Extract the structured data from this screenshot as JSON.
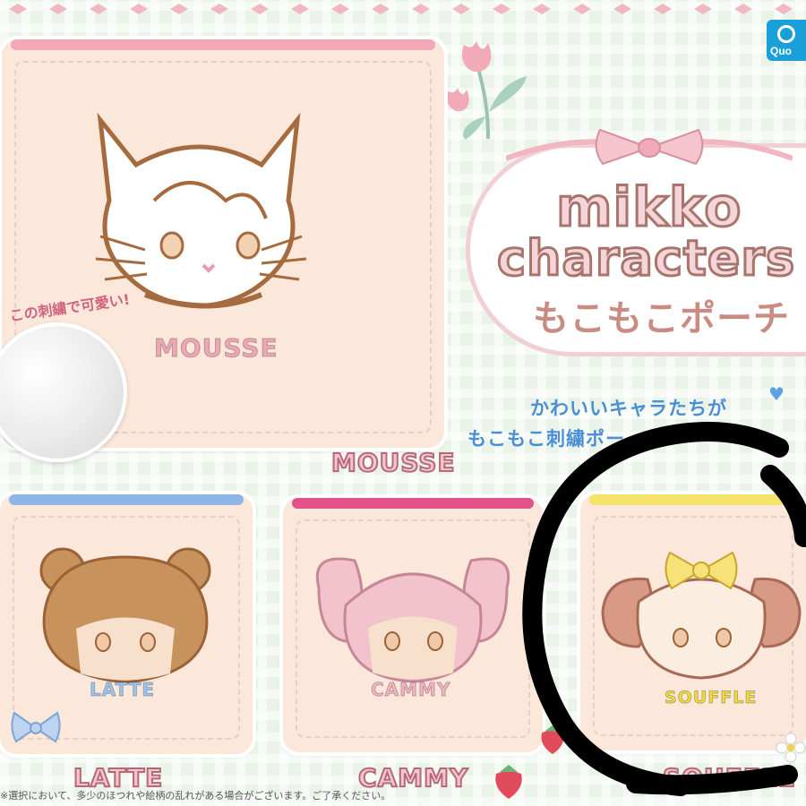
{
  "brand": {
    "logo_text": "Quo"
  },
  "title": {
    "line1": "mikko",
    "line2": "characters",
    "line3": "もこもこポーチ"
  },
  "tagline": {
    "line1": "かわいいキャラたちが",
    "line2": "もこもこ刺繍ポー"
  },
  "callout": "この刺繍で可愛い!",
  "pouches": [
    {
      "name": "MOUSSE",
      "label": "MOUSSE",
      "zip_color": "#f4a7b4",
      "name_color": "#f0a7b5"
    },
    {
      "name": "LATTE",
      "label": "LATTE",
      "zip_color": "#8fb6e8",
      "name_color": "#9cc6ef"
    },
    {
      "name": "CAMMY",
      "label": "CAMMY",
      "zip_color": "#e3508a",
      "name_color": "#f3b5c4"
    },
    {
      "name": "SOUFFLE",
      "label": "SOUFFLE",
      "zip_color": "#f4e46b",
      "name_color": "#f2dc3a"
    }
  ],
  "footnote": "※選択において、多少のほつれや絵柄の乱れがある場合がございます。ご了承ください。",
  "colors": {
    "background": "#eaf3e8",
    "title_outline": "#a8746c",
    "tagline": "#4a8fd6",
    "circle_overlay": "#000000"
  }
}
